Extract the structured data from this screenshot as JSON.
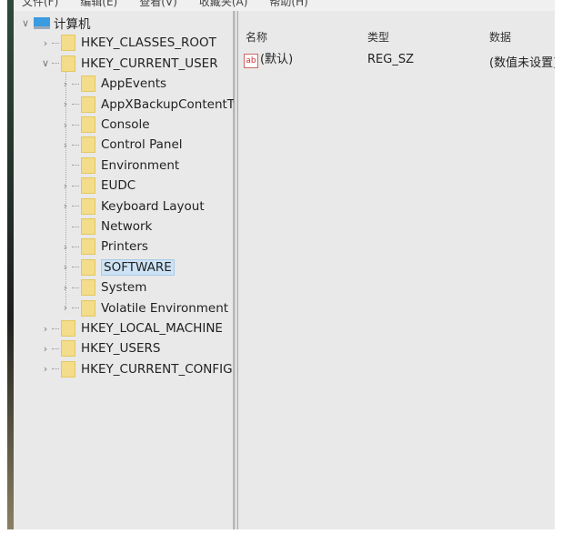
{
  "menu": [
    "文件(F)",
    "编辑(E)",
    "查看(V)",
    "收藏夹(A)",
    "帮助(H)"
  ],
  "tree": {
    "root": "计算机",
    "hives": [
      "HKEY_CLASSES_ROOT",
      "HKEY_CURRENT_USER",
      "HKEY_LOCAL_MACHINE",
      "HKEY_USERS",
      "HKEY_CURRENT_CONFIG"
    ],
    "hkcu_children": [
      {
        "label": "AppEvents",
        "expandable": true
      },
      {
        "label": "AppXBackupContentType",
        "expandable": true
      },
      {
        "label": "Console",
        "expandable": true
      },
      {
        "label": "Control Panel",
        "expandable": true
      },
      {
        "label": "Environment",
        "expandable": false
      },
      {
        "label": "EUDC",
        "expandable": true
      },
      {
        "label": "Keyboard Layout",
        "expandable": true
      },
      {
        "label": "Network",
        "expandable": false
      },
      {
        "label": "Printers",
        "expandable": true
      },
      {
        "label": "SOFTWARE",
        "expandable": true,
        "selected": true
      },
      {
        "label": "System",
        "expandable": true
      },
      {
        "label": "Volatile Environment",
        "expandable": true
      }
    ]
  },
  "columns": [
    "名称",
    "类型",
    "数据"
  ],
  "values": [
    {
      "name": "(默认)",
      "type": "REG_SZ",
      "data": "(数值未设置)",
      "icon": "ab"
    }
  ]
}
